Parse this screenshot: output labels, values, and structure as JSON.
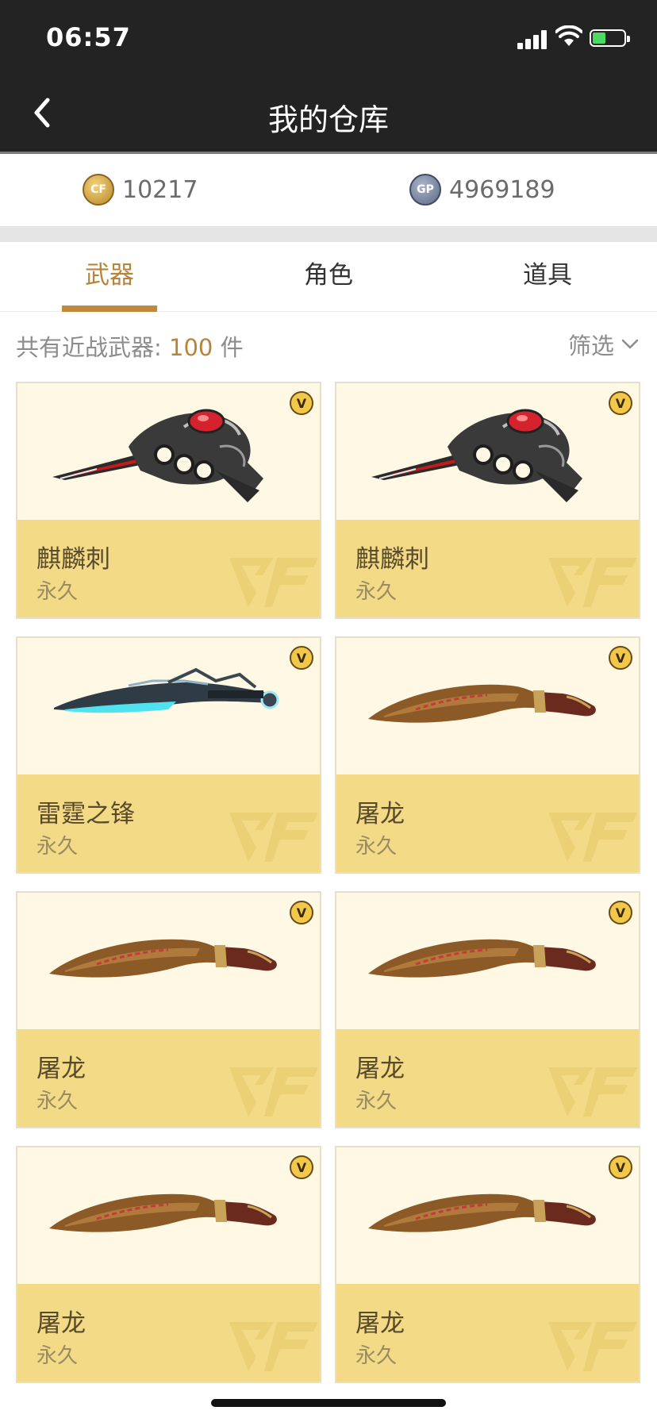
{
  "status": {
    "time": "06:57"
  },
  "header": {
    "title": "我的仓库"
  },
  "currency": {
    "cf_points": "10217",
    "gp": "4969189"
  },
  "tabs": [
    {
      "label": "武器",
      "active": true
    },
    {
      "label": "角色",
      "active": false
    },
    {
      "label": "道具",
      "active": false
    }
  ],
  "summary": {
    "prefix": "共有近战武器: ",
    "count": "100",
    "suffix": " 件"
  },
  "filter": {
    "label": "筛选"
  },
  "items": [
    {
      "name": "麒麟刺",
      "duration": "永久",
      "weapon": "knuckle-blade"
    },
    {
      "name": "麒麟刺",
      "duration": "永久",
      "weapon": "knuckle-blade"
    },
    {
      "name": "雷霆之锋",
      "duration": "永久",
      "weapon": "cyan-blade"
    },
    {
      "name": "屠龙",
      "duration": "永久",
      "weapon": "kukri"
    },
    {
      "name": "屠龙",
      "duration": "永久",
      "weapon": "kukri"
    },
    {
      "name": "屠龙",
      "duration": "永久",
      "weapon": "kukri"
    },
    {
      "name": "屠龙",
      "duration": "永久",
      "weapon": "kukri"
    },
    {
      "name": "屠龙",
      "duration": "永久",
      "weapon": "kukri"
    }
  ],
  "colors": {
    "accent": "#b8843b",
    "card_top": "#fef8e4",
    "card_bottom": "#f2da86",
    "header_bg": "#232323"
  }
}
